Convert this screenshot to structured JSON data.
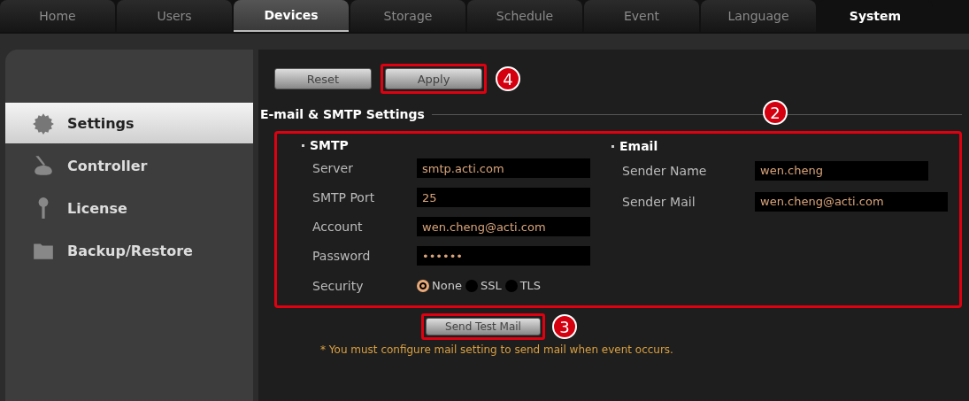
{
  "tabs": [
    {
      "label": "Home",
      "selected": false,
      "hovered": false
    },
    {
      "label": "Users",
      "selected": false,
      "hovered": false
    },
    {
      "label": "Devices",
      "selected": false,
      "hovered": true
    },
    {
      "label": "Storage",
      "selected": false,
      "hovered": false
    },
    {
      "label": "Schedule",
      "selected": false,
      "hovered": false
    },
    {
      "label": "Event",
      "selected": false,
      "hovered": false
    },
    {
      "label": "Language",
      "selected": false,
      "hovered": false
    },
    {
      "label": "System",
      "selected": true,
      "hovered": false
    }
  ],
  "sidebar": {
    "items": [
      {
        "label": "Settings",
        "selected": true
      },
      {
        "label": "Controller",
        "selected": false
      },
      {
        "label": "License",
        "selected": false
      },
      {
        "label": "Backup/Restore",
        "selected": false
      }
    ]
  },
  "buttons": [
    {
      "label": "Reset"
    },
    {
      "label": "Apply",
      "callout": "4"
    }
  ],
  "section": {
    "title": "E-mail & SMTP Settings",
    "callout": "2",
    "smtp": {
      "title": "SMTP",
      "fields": [
        {
          "label": "Server",
          "value": "smtp.acti.com"
        },
        {
          "label": "SMTP Port",
          "value": "25"
        },
        {
          "label": "Account",
          "value": "wen.cheng@acti.com"
        },
        {
          "label": "Password",
          "value": "••••••"
        }
      ],
      "security": {
        "label": "Security",
        "options": [
          {
            "label": "None",
            "selected": true
          },
          {
            "label": "SSL",
            "selected": false
          },
          {
            "label": "TLS",
            "selected": false
          }
        ]
      }
    },
    "email": {
      "title": "Email",
      "fields": [
        {
          "label": "Sender Name",
          "value": "wen.cheng"
        },
        {
          "label": "Sender Mail",
          "value": "wen.cheng@acti.com"
        }
      ]
    }
  },
  "test_button": {
    "label": "Send Test Mail",
    "callout": "3"
  },
  "note": "* You must configure mail setting to send mail when event occurs."
}
